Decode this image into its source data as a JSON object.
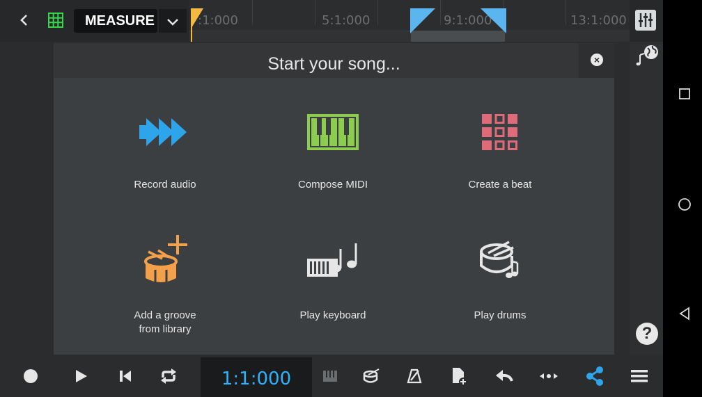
{
  "toolbar": {
    "measure_label": "MEASURE",
    "ruler_labels": [
      ":1:000",
      "5:1:000",
      "9:1:000",
      "13:1:000"
    ],
    "colors": {
      "accent_blue": "#5bb6f0",
      "playhead_yellow": "#f5b942",
      "grid_green": "#35d64a"
    }
  },
  "dialog": {
    "title": "Start your song...",
    "options": [
      {
        "label": "Record audio",
        "icon": "record-audio-icon",
        "color": "#2ea4ea"
      },
      {
        "label": "Compose MIDI",
        "icon": "piano-keys-icon",
        "color": "#8ccc4e"
      },
      {
        "label": "Create a beat",
        "icon": "beat-pads-icon",
        "color": "#df6a7a"
      },
      {
        "label": "Add a groove\nfrom library",
        "icon": "drum-plus-icon",
        "color": "#f4a04a"
      },
      {
        "label": "Play keyboard",
        "icon": "keyboard-notes-icon",
        "color": "#e6e6e6"
      },
      {
        "label": "Play drums",
        "icon": "drum-note-icon",
        "color": "#e6e6e6"
      }
    ]
  },
  "transport": {
    "time": "1:1:000",
    "buttons": [
      "record-icon",
      "play-icon",
      "rewind-icon",
      "loop-icon",
      "keyboard-icon",
      "drum-icon",
      "metronome-icon",
      "add-file-icon",
      "undo-icon",
      "move-icon",
      "share-icon",
      "menu-icon"
    ]
  },
  "help": {
    "label": "?"
  }
}
